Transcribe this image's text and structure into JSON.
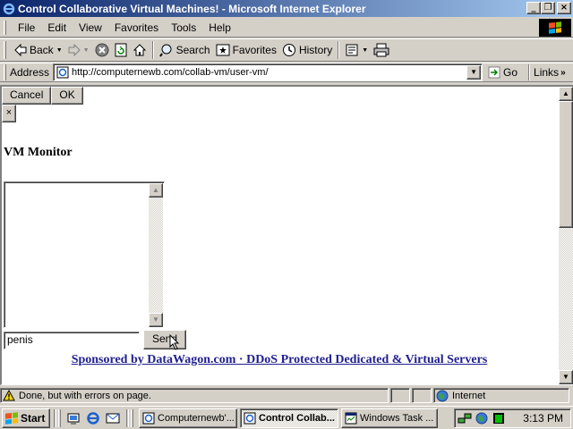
{
  "window": {
    "title": "Control Collaborative Virtual Machines! - Microsoft Internet Explorer",
    "controls": [
      "minimize",
      "restore",
      "close"
    ]
  },
  "menubar": {
    "items": [
      "File",
      "Edit",
      "View",
      "Favorites",
      "Tools",
      "Help"
    ]
  },
  "toolbar": {
    "back_label": "Back",
    "search_label": "Search",
    "favorites_label": "Favorites",
    "history_label": "History"
  },
  "address": {
    "label": "Address",
    "url": "http://computernewb.com/collab-vm/user-vm/",
    "go_label": "Go",
    "links_label": "Links"
  },
  "page": {
    "cancel_label": "Cancel",
    "ok_label": "OK",
    "close_glyph": "×",
    "heading": "VM Monitor",
    "chat_input_value": "penis",
    "send_label": "Send",
    "sponsor_text": "Sponsored by DataWagon.com · DDoS Protected Dedicated & Virtual Servers"
  },
  "statusbar": {
    "message": "Done, but with errors on page.",
    "zone": "Internet"
  },
  "taskbar": {
    "start_label": "Start",
    "tasks": [
      {
        "label": "Computernewb'...",
        "active": false
      },
      {
        "label": "Control Collab...",
        "active": true
      },
      {
        "label": "Windows Task ...",
        "active": false
      }
    ],
    "clock": "3:13 PM"
  },
  "colors": {
    "titlebar_start": "#0a246a",
    "titlebar_end": "#a6caf0",
    "face": "#d4d0c8",
    "link": "#1f1f8f"
  }
}
